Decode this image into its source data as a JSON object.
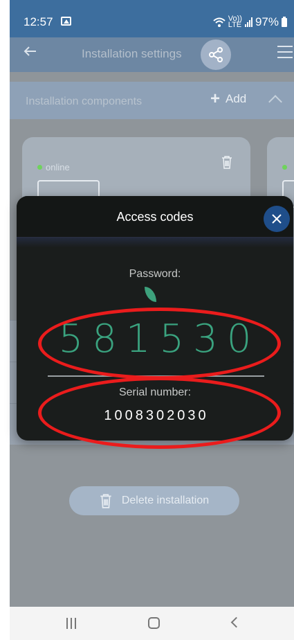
{
  "status_bar": {
    "time": "12:57",
    "network_top": "Vo))",
    "network_bottom": "LTE",
    "battery": "97%"
  },
  "header": {
    "title": "Installation settings"
  },
  "components": {
    "label": "Installation components",
    "add_label": "Add"
  },
  "cards": [
    {
      "status": "online"
    }
  ],
  "modal": {
    "title": "Access codes",
    "password_label": "Password:",
    "password_value": "581530",
    "serial_label": "Serial number:",
    "serial_value": "1008302030"
  },
  "footer": {
    "delete_label": "Delete installation"
  },
  "colors": {
    "status_bar": "#3d6e9e",
    "password_green": "#3aa37f",
    "close_button": "#1f4e8a",
    "annotation_red": "#ea1c1c",
    "online_green": "#6fd35c"
  },
  "icons": {
    "back": "arrow-left-icon",
    "share": "share-icon",
    "menu": "hamburger-menu-icon",
    "add": "plus-icon",
    "collapse": "chevron-up-icon",
    "trash": "trash-icon",
    "close": "close-icon",
    "leaf": "leaf-icon"
  }
}
